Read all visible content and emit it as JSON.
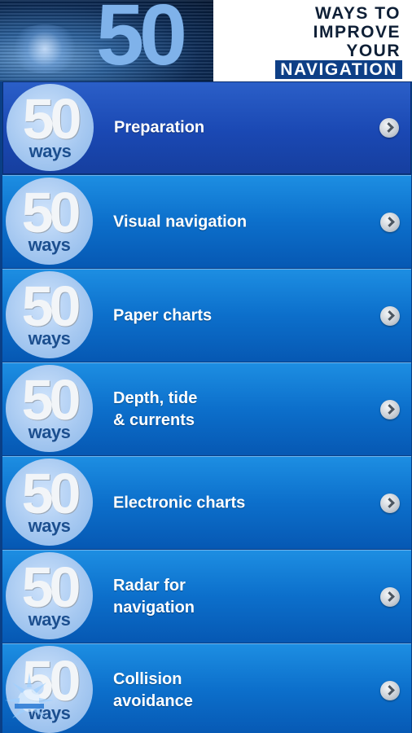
{
  "header": {
    "big_number": "50",
    "title_lines": [
      "WAYS TO",
      "IMPROVE",
      "YOUR",
      "NAVIGATION"
    ]
  },
  "badge": {
    "number": "50",
    "word": "ways"
  },
  "menu": [
    {
      "label": "Preparation",
      "selected": true
    },
    {
      "label": "Visual navigation"
    },
    {
      "label": "Paper charts"
    },
    {
      "label": "Depth, tide\n& currents"
    },
    {
      "label": "Electronic charts"
    },
    {
      "label": "Radar for\nnavigation"
    },
    {
      "label": "Collision\navoidance"
    }
  ],
  "colors": {
    "item_gradient_top": "#1d8ee2",
    "item_gradient_bottom": "#0658b3",
    "selected_gradient_top": "#2b5fc8",
    "badge": "#a7c9f1",
    "header_accent": "#7fb2ea"
  },
  "icons": {
    "chevron": "chevron-right-icon",
    "logo": "sun-logo-icon"
  }
}
